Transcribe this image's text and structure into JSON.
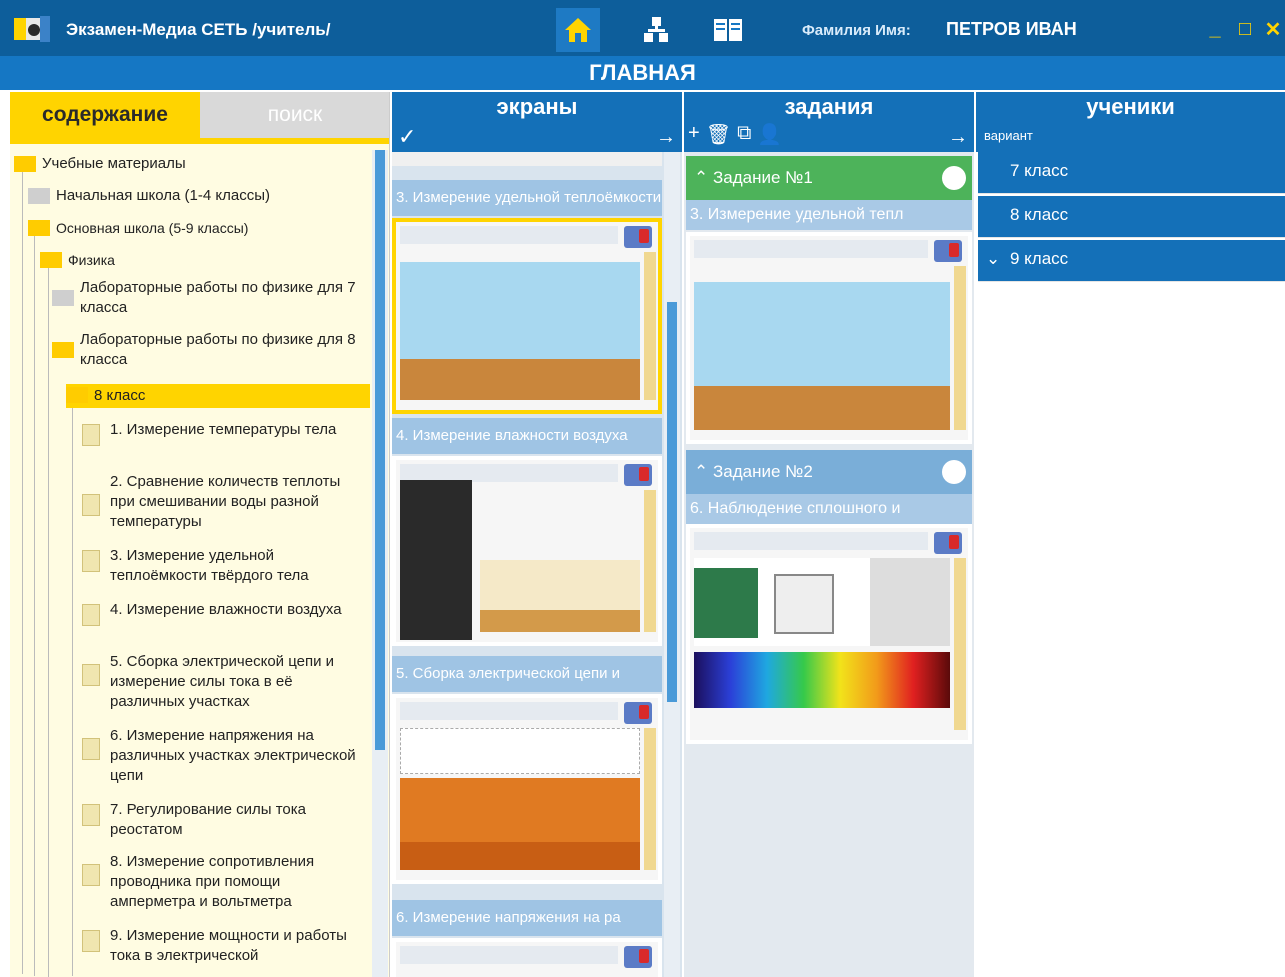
{
  "window": {
    "app_title": "Экзамен-Медиа СЕТЬ /учитель/",
    "user_label": "Фамилия Имя:",
    "user_name": "ПЕТРОВ ИВАН",
    "minimize": "_",
    "maximize": "□",
    "close": "✕"
  },
  "main_header": "ГЛАВНАЯ",
  "left_panel": {
    "tabs": {
      "content": "содержание",
      "search": "поиск"
    },
    "tree": [
      {
        "label": "Учебные материалы",
        "kind": "folder-y"
      },
      {
        "label": "Начальная школа (1-4 классы)",
        "kind": "folder-g"
      },
      {
        "label": "Основная школа (5-9 классы)",
        "kind": "folder-y"
      },
      {
        "label": "Физика",
        "kind": "folder-y"
      },
      {
        "label": "Лабораторные работы по физике для 7 класса",
        "kind": "folder-g"
      },
      {
        "label": "Лабораторные работы по физике для 8 класса",
        "kind": "folder-y"
      },
      {
        "label": "8 класс",
        "kind": "folder-y"
      },
      {
        "label": "1. Измерение температуры тела",
        "kind": "doc"
      },
      {
        "label": "2. Сравнение количеств теплоты при смешивании воды разной температуры",
        "kind": "doc"
      },
      {
        "label": "3. Измерение удельной теплоёмкости твёрдого тела",
        "kind": "doc"
      },
      {
        "label": "4. Измерение влажности воздуха",
        "kind": "doc"
      },
      {
        "label": "5. Сборка электрической цепи и измерение силы тока в её различных участках",
        "kind": "doc"
      },
      {
        "label": "6. Измерение напряжения на различных участках электрической цепи",
        "kind": "doc"
      },
      {
        "label": "7. Регулирование силы тока реостатом",
        "kind": "doc"
      },
      {
        "label": "8. Измерение сопротивления проводника при помощи амперметра и вольтметра",
        "kind": "doc"
      },
      {
        "label": "9. Измерение мощности и работы тока в электрической",
        "kind": "doc"
      }
    ]
  },
  "screens": {
    "title": "экраны",
    "check": "✓",
    "arrow": "→",
    "items": [
      "3. Измерение удельной теплоёмкости",
      "4. Измерение влажности воздуха",
      "5. Сборка электрической цепи и",
      "6. Измерение напряжения на ра"
    ]
  },
  "tasks": {
    "title": "задания",
    "arrow": "→",
    "toolbar": [
      "+",
      "🗑",
      "⧉",
      "👤"
    ],
    "items": [
      {
        "label": "Задание №1",
        "screen": "3. Измерение удельной тепл",
        "color": "#4db35a"
      },
      {
        "label": "Задание №2",
        "screen": "6. Наблюдение сплошного и",
        "color": "#7aaed8"
      }
    ]
  },
  "students": {
    "title": "ученики",
    "sub": "вариант",
    "classes": [
      "7 класс",
      "8 класс",
      "9 класс"
    ]
  }
}
